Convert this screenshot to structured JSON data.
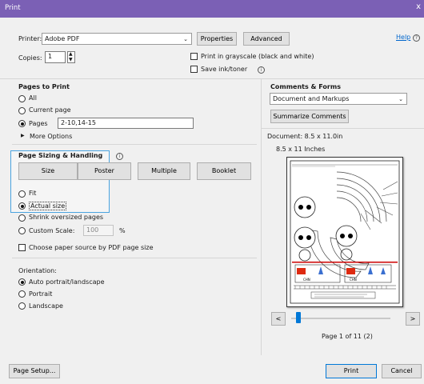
{
  "window": {
    "title": "Print",
    "close_glyph": "x"
  },
  "top": {
    "printer_label": "Printer:",
    "printer_value": "Adobe PDF",
    "properties_label": "Properties",
    "advanced_label": "Advanced",
    "help_label": "Help",
    "copies_label": "Copies:",
    "copies_value": "1",
    "grayscale_label": "Print in grayscale (black and white)",
    "save_ink_label": "Save ink/toner"
  },
  "pages_to_print": {
    "title": "Pages to Print",
    "all_label": "All",
    "current_label": "Current page",
    "pages_label": "Pages",
    "pages_value": "2-10,14-15",
    "more_options_label": "More Options",
    "selected": "Pages"
  },
  "sizing": {
    "title": "Page Sizing & Handling",
    "tabs": [
      "Size",
      "Poster",
      "Multiple",
      "Booklet"
    ],
    "fit_label": "Fit",
    "actual_label": "Actual size",
    "shrink_label": "Shrink oversized pages",
    "custom_label": "Custom Scale:",
    "custom_value": "100",
    "percent": "%",
    "pdf_source_label": "Choose paper source by PDF page size",
    "selected": "Actual size"
  },
  "orientation": {
    "title": "Orientation:",
    "auto_label": "Auto portrait/landscape",
    "portrait_label": "Portrait",
    "landscape_label": "Landscape",
    "selected": "Auto portrait/landscape"
  },
  "comments": {
    "title": "Comments & Forms",
    "value": "Document and Markups",
    "summarize_label": "Summarize Comments"
  },
  "preview": {
    "document_size": "Document: 8.5 x 11.0in",
    "paper_size": "8.5 x 11 Inches",
    "chn_label": "CHN",
    "page_counter": "Page 1 of 11 (2)",
    "prev_glyph": "<",
    "next_glyph": ">",
    "slider_level": 0.05
  },
  "bottom": {
    "page_setup_label": "Page Setup...",
    "print_label": "Print",
    "cancel_label": "Cancel"
  },
  "colors": {
    "title_bar": "#7b60b5",
    "accent": "#0078d7",
    "link": "#0066cc"
  }
}
